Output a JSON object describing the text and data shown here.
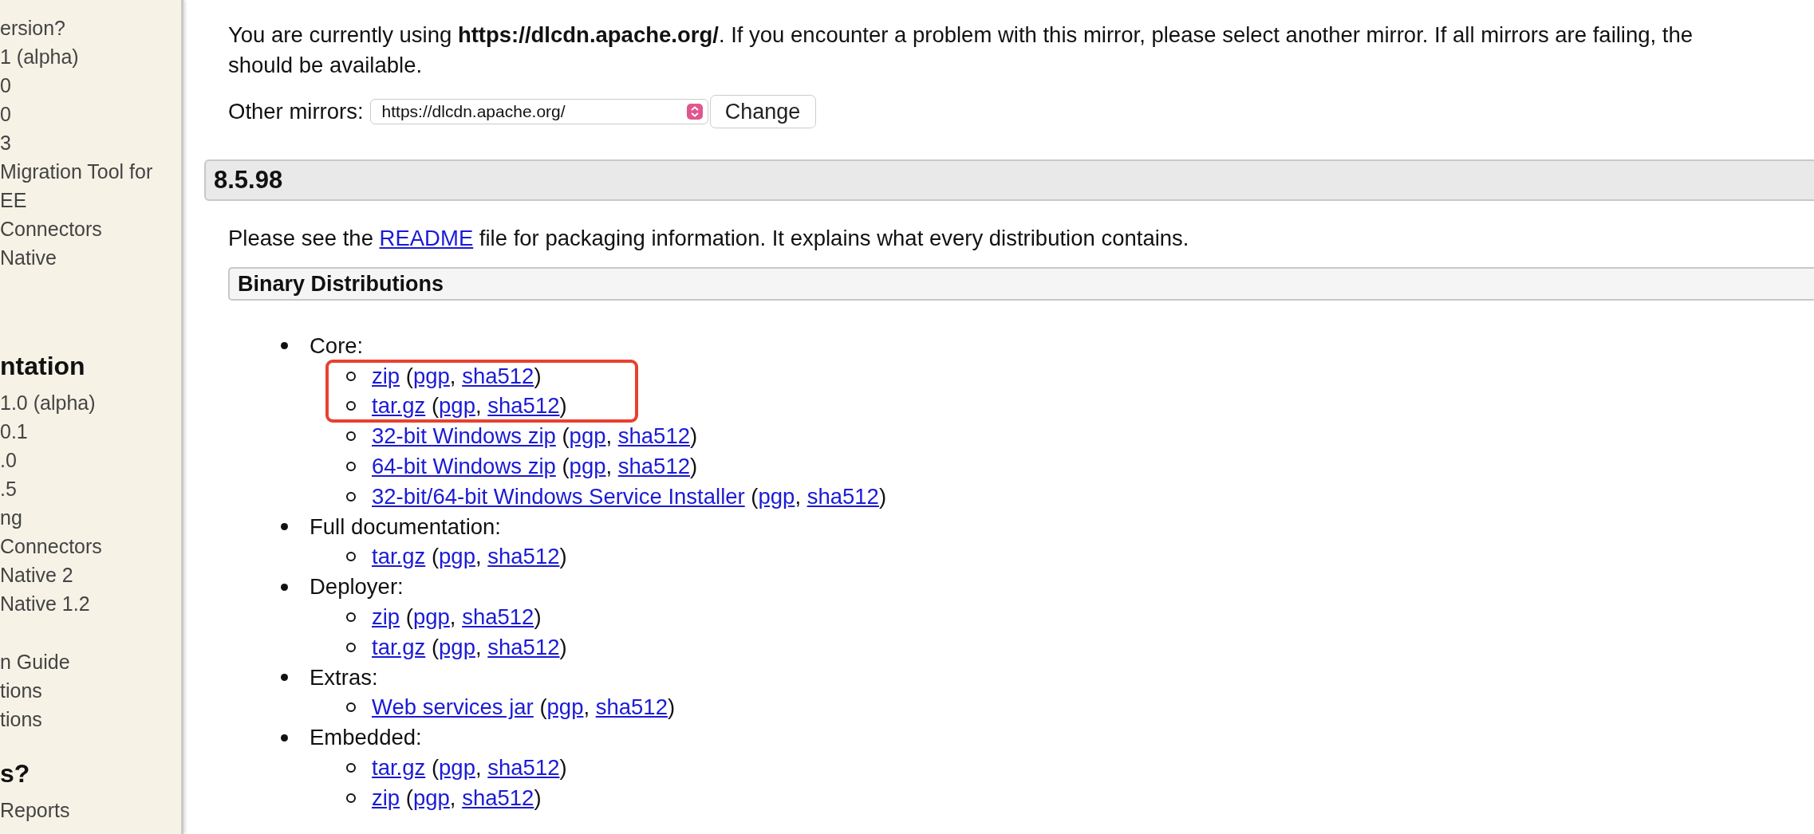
{
  "sidebar": {
    "sections": [
      {
        "items": [
          "ersion?",
          "1 (alpha)",
          "0",
          "0",
          "3",
          "Migration Tool for",
          "EE",
          "Connectors",
          "Native"
        ]
      },
      {
        "heading": "ntation",
        "items": [
          "1.0 (alpha)",
          "0.1",
          ".0",
          ".5",
          "ng",
          "Connectors",
          "Native 2",
          "Native 1.2"
        ]
      },
      {
        "items": [
          "n Guide",
          "tions",
          "tions"
        ]
      },
      {
        "heading": "s?",
        "items": [
          "Reports"
        ]
      }
    ]
  },
  "mirror_notice": "You are currently using **https://dlcdn.apache.org/**. If you encounter a problem with this mirror, please select another mirror. If all mirrors are failing, the\nshould be available.",
  "mirrors": {
    "label": "Other mirrors:",
    "selected_mirror": "https://dlcdn.apache.org/",
    "button": "Change"
  },
  "release": {
    "version": "8.5.98",
    "readme_note": {
      "before": "Please see the ",
      "link": "README",
      "after": " file for packaging information. It explains what every distribution contains."
    },
    "binary_distributions": {
      "title": "Binary Distributions",
      "groups": [
        {
          "label": "Core:",
          "blocks": [
            {
              "highlighted": true,
              "files": [
                [
                  {
                    "kind": "link",
                    "text": "zip"
                  },
                  {
                    "kind": "plain",
                    "text": " ("
                  },
                  {
                    "kind": "link",
                    "text": "pgp"
                  },
                  {
                    "kind": "plain",
                    "text": ", "
                  },
                  {
                    "kind": "link",
                    "text": "sha512"
                  },
                  {
                    "kind": "plain",
                    "text": ")"
                  }
                ],
                [
                  {
                    "kind": "link",
                    "text": "tar.gz"
                  },
                  {
                    "kind": "plain",
                    "text": " ("
                  },
                  {
                    "kind": "link",
                    "text": "pgp"
                  },
                  {
                    "kind": "plain",
                    "text": ", "
                  },
                  {
                    "kind": "link",
                    "text": "sha512"
                  },
                  {
                    "kind": "plain",
                    "text": ")"
                  }
                ]
              ]
            },
            {
              "highlighted": false,
              "files": [
                [
                  {
                    "kind": "link",
                    "text": "32-bit Windows zip"
                  },
                  {
                    "kind": "plain",
                    "text": " ("
                  },
                  {
                    "kind": "link",
                    "text": "pgp"
                  },
                  {
                    "kind": "plain",
                    "text": ", "
                  },
                  {
                    "kind": "link",
                    "text": "sha512"
                  },
                  {
                    "kind": "plain",
                    "text": ")"
                  }
                ],
                [
                  {
                    "kind": "link",
                    "text": "64-bit Windows zip"
                  },
                  {
                    "kind": "plain",
                    "text": " ("
                  },
                  {
                    "kind": "link",
                    "text": "pgp"
                  },
                  {
                    "kind": "plain",
                    "text": ", "
                  },
                  {
                    "kind": "link",
                    "text": "sha512"
                  },
                  {
                    "kind": "plain",
                    "text": ")"
                  }
                ],
                [
                  {
                    "kind": "link",
                    "text": "32-bit/64-bit Windows Service Installer"
                  },
                  {
                    "kind": "plain",
                    "text": " ("
                  },
                  {
                    "kind": "link",
                    "text": "pgp"
                  },
                  {
                    "kind": "plain",
                    "text": ", "
                  },
                  {
                    "kind": "link",
                    "text": "sha512"
                  },
                  {
                    "kind": "plain",
                    "text": ")"
                  }
                ]
              ]
            }
          ]
        },
        {
          "label": "Full documentation:",
          "blocks": [
            {
              "highlighted": false,
              "files": [
                [
                  {
                    "kind": "link",
                    "text": "tar.gz"
                  },
                  {
                    "kind": "plain",
                    "text": " ("
                  },
                  {
                    "kind": "link",
                    "text": "pgp"
                  },
                  {
                    "kind": "plain",
                    "text": ", "
                  },
                  {
                    "kind": "link",
                    "text": "sha512"
                  },
                  {
                    "kind": "plain",
                    "text": ")"
                  }
                ]
              ]
            }
          ]
        },
        {
          "label": "Deployer:",
          "blocks": [
            {
              "highlighted": false,
              "files": [
                [
                  {
                    "kind": "link",
                    "text": "zip"
                  },
                  {
                    "kind": "plain",
                    "text": " ("
                  },
                  {
                    "kind": "link",
                    "text": "pgp"
                  },
                  {
                    "kind": "plain",
                    "text": ", "
                  },
                  {
                    "kind": "link",
                    "text": "sha512"
                  },
                  {
                    "kind": "plain",
                    "text": ")"
                  }
                ],
                [
                  {
                    "kind": "link",
                    "text": "tar.gz"
                  },
                  {
                    "kind": "plain",
                    "text": " ("
                  },
                  {
                    "kind": "link",
                    "text": "pgp"
                  },
                  {
                    "kind": "plain",
                    "text": ", "
                  },
                  {
                    "kind": "link",
                    "text": "sha512"
                  },
                  {
                    "kind": "plain",
                    "text": ")"
                  }
                ]
              ]
            }
          ]
        },
        {
          "label": "Extras:",
          "blocks": [
            {
              "highlighted": false,
              "files": [
                [
                  {
                    "kind": "link",
                    "text": "Web services jar"
                  },
                  {
                    "kind": "plain",
                    "text": " ("
                  },
                  {
                    "kind": "link",
                    "text": "pgp"
                  },
                  {
                    "kind": "plain",
                    "text": ", "
                  },
                  {
                    "kind": "link",
                    "text": "sha512"
                  },
                  {
                    "kind": "plain",
                    "text": ")"
                  }
                ]
              ]
            }
          ]
        },
        {
          "label": "Embedded:",
          "blocks": [
            {
              "highlighted": false,
              "files": [
                [
                  {
                    "kind": "link",
                    "text": "tar.gz"
                  },
                  {
                    "kind": "plain",
                    "text": " ("
                  },
                  {
                    "kind": "link",
                    "text": "pgp"
                  },
                  {
                    "kind": "plain",
                    "text": ", "
                  },
                  {
                    "kind": "link",
                    "text": "sha512"
                  },
                  {
                    "kind": "plain",
                    "text": ")"
                  }
                ],
                [
                  {
                    "kind": "link",
                    "text": "zip"
                  },
                  {
                    "kind": "plain",
                    "text": " ("
                  },
                  {
                    "kind": "link",
                    "text": "pgp"
                  },
                  {
                    "kind": "plain",
                    "text": ", "
                  },
                  {
                    "kind": "link",
                    "text": "sha512"
                  },
                  {
                    "kind": "plain",
                    "text": ")"
                  }
                ]
              ]
            }
          ]
        }
      ]
    }
  }
}
